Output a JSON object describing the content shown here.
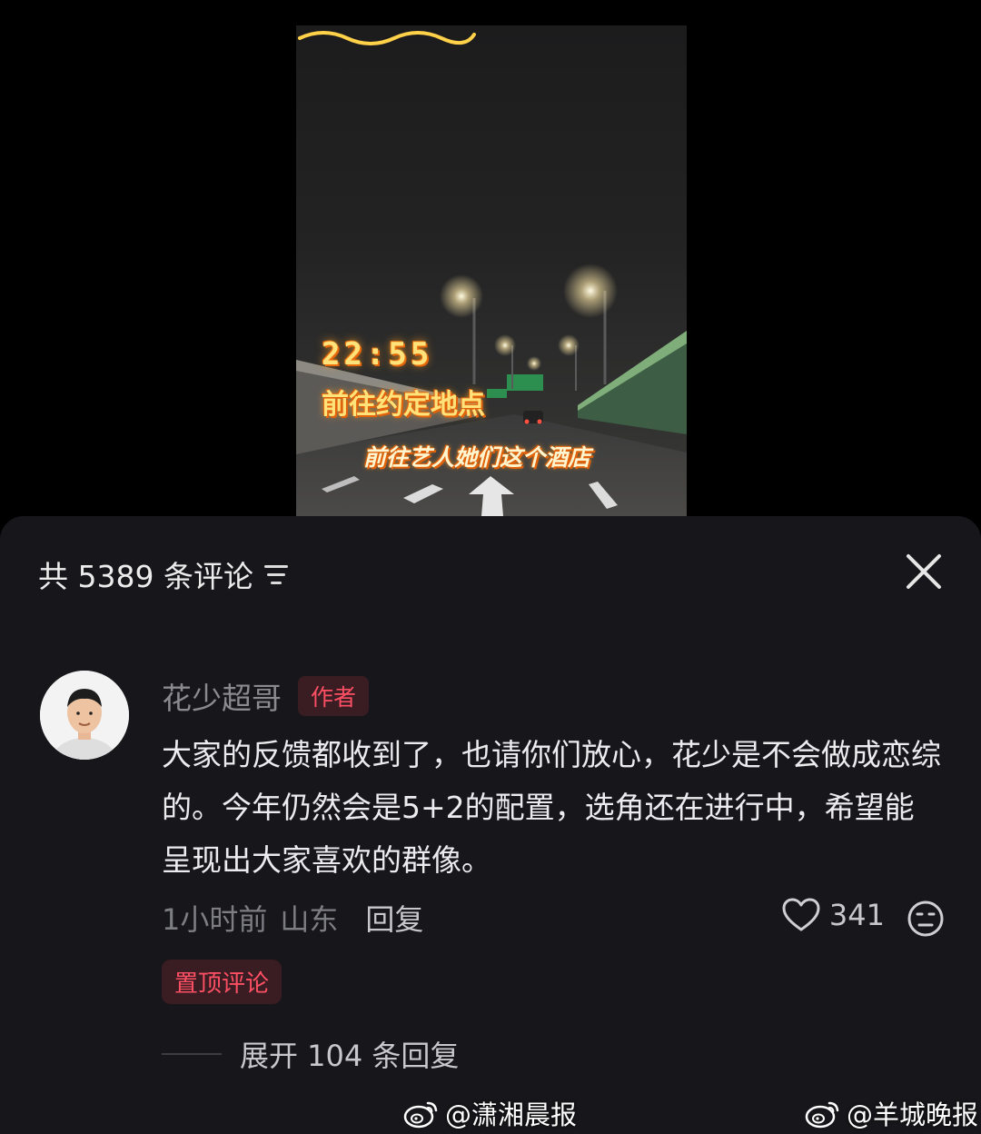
{
  "video": {
    "overlay_time": "22:55",
    "overlay_destination": "前往约定地点",
    "overlay_subtitle": "前往艺人她们这个酒店"
  },
  "panel": {
    "header_title": "共 5389 条评论",
    "filter_icon": "sort-filter-icon",
    "close_icon": "close-icon"
  },
  "comment": {
    "author": "花少超哥",
    "author_badge": "作者",
    "text": "大家的反馈都收到了，也请你们放心，花少是不会做成恋综的。今年仍然会是5+2的配置，选角还在进行中，希望能呈现出大家喜欢的群像。",
    "time": "1小时前",
    "location": "山东",
    "reply_label": "回复",
    "like_count": "341",
    "pinned_label": "置顶评论",
    "expand_label": "展开 104 条回复"
  },
  "watermarks": {
    "left": "@潇湘晨报",
    "right": "@羊城晚报"
  },
  "colors": {
    "panel_bg": "#17171b",
    "accent_red": "#ff4f65",
    "overlay_yellow": "#ffe27a"
  }
}
